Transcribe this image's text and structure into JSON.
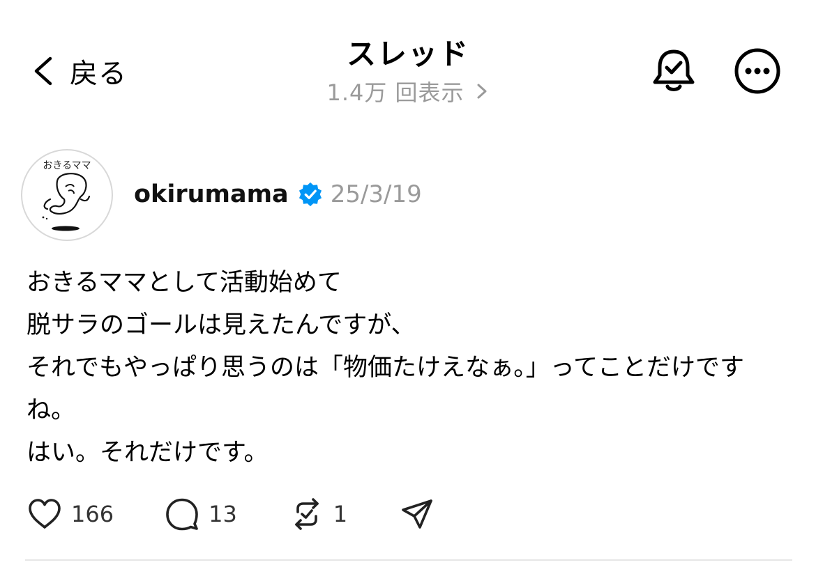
{
  "header": {
    "back_label": "戻る",
    "title": "スレッド",
    "views": "1.4万 回表示"
  },
  "post": {
    "avatar_text": "おきるママ",
    "username": "okirumama",
    "verified": true,
    "date": "25/3/19",
    "lines": [
      "おきるママとして活動始めて",
      "脱サラのゴールは見えたんですが、",
      "それでもやっぱり思うのは「物価たけえなぁ。」ってことだけです",
      "ね。",
      "はい。それだけです。"
    ],
    "stats": {
      "likes": "166",
      "replies": "13",
      "reposts": "1"
    }
  },
  "colors": {
    "verified_blue": "#0095f6",
    "muted_gray": "#9a9a9a",
    "divider": "#e6e6e6"
  },
  "icons": {
    "back": "chevron-left-icon",
    "views": "chevron-right-icon",
    "notify": "bell-check-icon",
    "more": "more-horizontal-icon",
    "like": "heart-icon",
    "reply": "speech-bubble-icon",
    "repost": "repost-icon",
    "share": "send-icon"
  }
}
